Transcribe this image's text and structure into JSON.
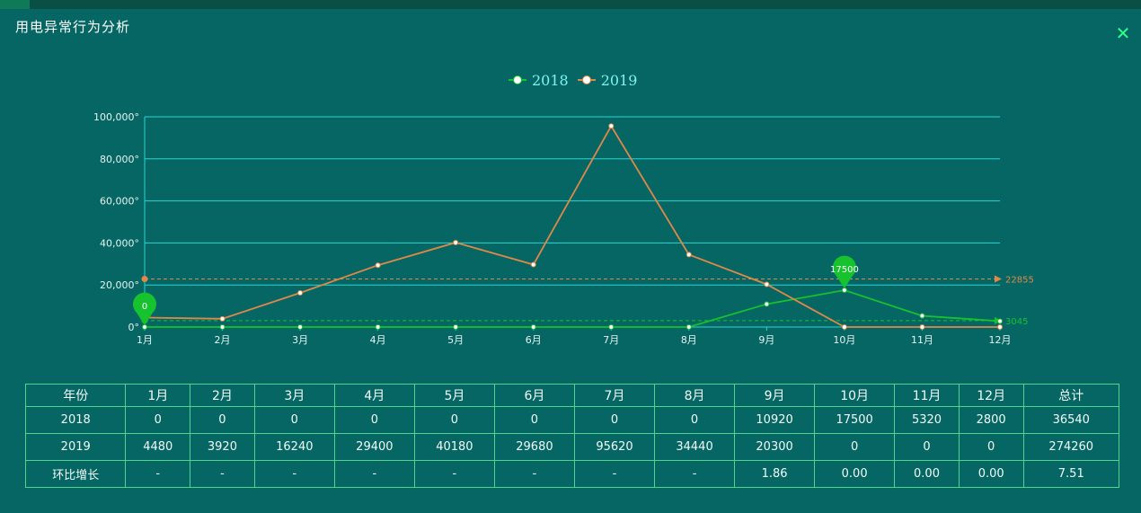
{
  "window": {
    "title": "用电异常行为分析"
  },
  "legend": [
    {
      "name": "2018",
      "color": "#16c22e"
    },
    {
      "name": "2019",
      "color": "#e0884a"
    }
  ],
  "chart_data": {
    "type": "line",
    "categories": [
      "1月",
      "2月",
      "3月",
      "4月",
      "5月",
      "6月",
      "7月",
      "8月",
      "9月",
      "10月",
      "11月",
      "12月"
    ],
    "series": [
      {
        "name": "2018",
        "color": "#16c22e",
        "values": [
          0,
          0,
          0,
          0,
          0,
          0,
          0,
          0,
          10920,
          17500,
          5320,
          2800
        ]
      },
      {
        "name": "2019",
        "color": "#e0884a",
        "values": [
          4480,
          3920,
          16240,
          29400,
          40180,
          29680,
          95620,
          34440,
          20300,
          0,
          0,
          0
        ]
      }
    ],
    "y_ticks": [
      "0°",
      "20,000°",
      "40,000°",
      "60,000°",
      "80,000°",
      "100,000°"
    ],
    "ylim": [
      0,
      100000
    ],
    "grid": true,
    "legend_position": "top-center",
    "mark_points": [
      {
        "series": "2018",
        "month": "1月",
        "label": "0"
      },
      {
        "series": "2018",
        "month": "10月",
        "label": "17500"
      }
    ],
    "mark_lines": [
      {
        "series": "2019",
        "value": 22855,
        "label": "22855"
      },
      {
        "series": "2018",
        "value": 3045,
        "label": "3045"
      }
    ]
  },
  "table": {
    "header": [
      "年份",
      "1月",
      "2月",
      "3月",
      "4月",
      "5月",
      "6月",
      "7月",
      "8月",
      "9月",
      "10月",
      "11月",
      "12月",
      "总计"
    ],
    "rows": [
      [
        "2018",
        "0",
        "0",
        "0",
        "0",
        "0",
        "0",
        "0",
        "0",
        "10920",
        "17500",
        "5320",
        "2800",
        "36540"
      ],
      [
        "2019",
        "4480",
        "3920",
        "16240",
        "29400",
        "40180",
        "29680",
        "95620",
        "34440",
        "20300",
        "0",
        "0",
        "0",
        "274260"
      ],
      [
        "环比增长",
        "-",
        "-",
        "-",
        "-",
        "-",
        "-",
        "-",
        "-",
        "1.86",
        "0.00",
        "0.00",
        "0.00",
        "7.51"
      ]
    ]
  },
  "colors": {
    "background": "#066664",
    "grid": "#27d6d6",
    "axis_text": "#e6f4f2",
    "table_border": "#4fd58c",
    "close": "#2bff8c"
  }
}
